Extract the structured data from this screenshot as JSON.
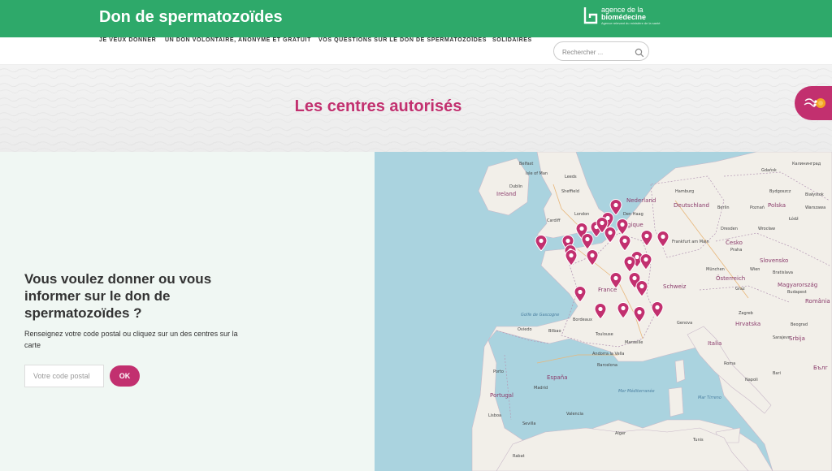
{
  "header": {
    "site_title": "Don de spermatozoïdes",
    "logo": {
      "line1": "agence de la",
      "line2": "biomédecine",
      "tagline": "Agence relevant du ministère de la santé"
    }
  },
  "nav": {
    "items": [
      {
        "label": "JE VEUX DONNER"
      },
      {
        "label": "UN DON VOLONTAIRE, ANONYME ET GRATUIT"
      },
      {
        "label": "VOS QUESTIONS SUR LE DON DE SPERMATOZOÏDES"
      },
      {
        "label": "SOLIDAIRES"
      }
    ],
    "search_placeholder": "Rechercher ..."
  },
  "banner": {
    "title": "Les centres autorisés"
  },
  "left": {
    "heading": "Vous voulez donner ou vous informer sur le don de spermatozoïdes ?",
    "description": "Renseignez votre code postal ou cliquez sur un des centres sur la carte",
    "postal_placeholder": "Votre code postal",
    "ok_label": "OK"
  },
  "map": {
    "countries": [
      "Ireland",
      "Nederland",
      "Deutschland",
      "Polska",
      "Belgique",
      "Česko",
      "Slovensko",
      "Österreich",
      "Magyarország",
      "France",
      "Schweiz",
      "Italia",
      "España",
      "Portugal",
      "Hrvatska",
      "Srbija",
      "Бълг",
      "România"
    ],
    "cities": [
      "Belfast",
      "Isle of Man",
      "Dublin",
      "Leeds",
      "Sheffield",
      "Cardiff",
      "London",
      "Den Haag",
      "Hamburg",
      "Berlin",
      "Gdańsk",
      "Bydgoszcz",
      "Warszawa",
      "Białystok",
      "Poznań",
      "Łódź",
      "Dresden",
      "Wrocław",
      "Frankfurt am Main",
      "Praha",
      "München",
      "Wien",
      "Bratislava",
      "Budapest",
      "Graz",
      "Zagreb",
      "Genova",
      "Marseille",
      "Bordeaux",
      "Toulouse",
      "Barcelona",
      "Madrid",
      "Lisboa",
      "Porto",
      "Oviedo",
      "Bilbao",
      "Valencia",
      "Roma",
      "Napoli",
      "Bari",
      "Tunis",
      "Alger",
      "Rabat",
      "Sevilla",
      "Andorra la Vella",
      "Sarajevo",
      "Beograd",
      "Калининград"
    ],
    "seas": [
      "Golfe de Gascogne",
      "Mer Méditerranée",
      "Mar Tirreno"
    ],
    "marker_color": "#c2306f",
    "marker_count": 27
  },
  "colors": {
    "header_green": "#2ea96a",
    "accent_pink": "#c2306f",
    "panel_bg": "#f0f7f3",
    "sea": "#aad3df",
    "land": "#f2efe9"
  }
}
